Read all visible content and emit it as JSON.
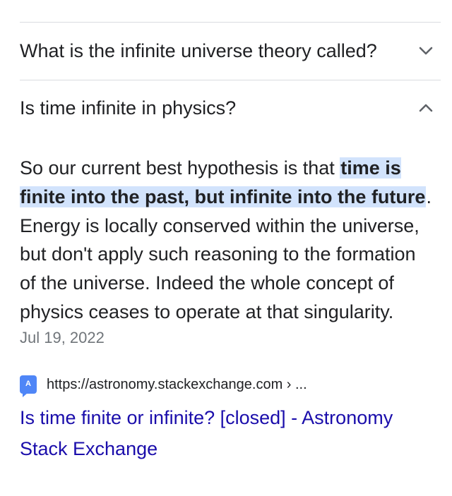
{
  "faq": {
    "q1": {
      "text": "What is the infinite universe theory called?",
      "icon": "chevron-down-icon",
      "expanded": false
    },
    "q2": {
      "text": "Is time infinite in physics?",
      "icon": "chevron-up-icon",
      "expanded": true
    }
  },
  "answer": {
    "pre": "So our current best hypothesis is that ",
    "highlight": "time is finite into the past, but infinite into the future",
    "post": ". Energy is locally conserved within the universe, but don't apply such reasoning to the formation of the universe. Indeed the whole concept of physics ceases to operate at that singularity.",
    "date": "Jul 19, 2022"
  },
  "source": {
    "favicon_letter": "A",
    "url": "https://astronomy.stackexchange.com › ...",
    "title": "Is time finite or infinite? [closed] - Astronomy Stack Exchange"
  },
  "colors": {
    "text": "#202124",
    "divider": "#dadce0",
    "highlight_bg": "#d2e3fc",
    "link": "#1a0dab",
    "date": "#70757a",
    "favicon": "#4f86f7"
  }
}
